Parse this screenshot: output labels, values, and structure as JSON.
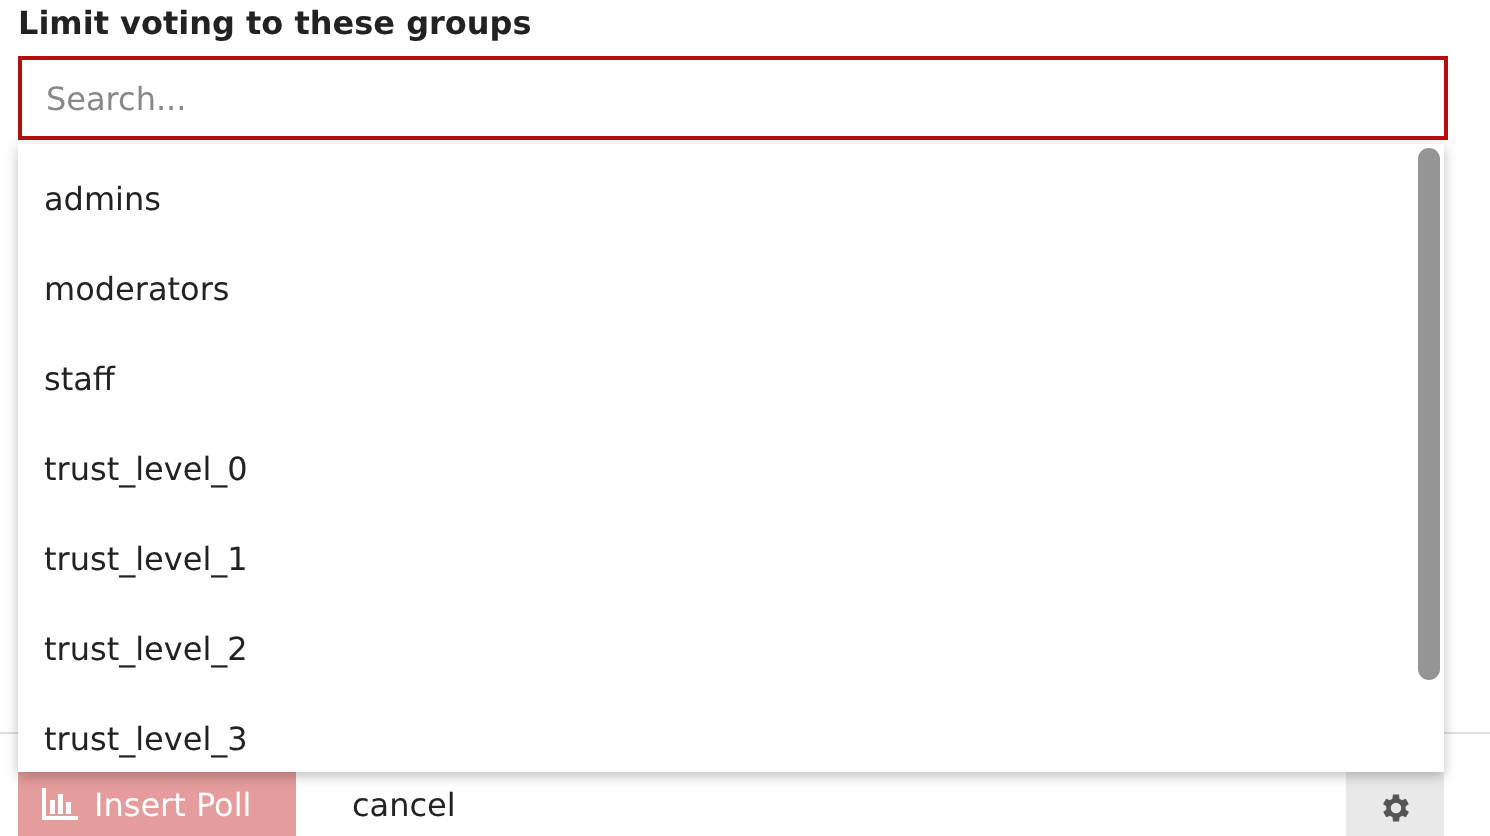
{
  "field": {
    "label": "Limit voting to these groups",
    "placeholder": "Search..."
  },
  "dropdown": {
    "items": [
      {
        "label": "admins"
      },
      {
        "label": "moderators"
      },
      {
        "label": "staff"
      },
      {
        "label": "trust_level_0"
      },
      {
        "label": "trust_level_1"
      },
      {
        "label": "trust_level_2"
      },
      {
        "label": "trust_level_3"
      }
    ]
  },
  "footer": {
    "insert_button": {
      "label": "Insert Poll",
      "disabled": true
    },
    "cancel_link": "cancel"
  }
}
